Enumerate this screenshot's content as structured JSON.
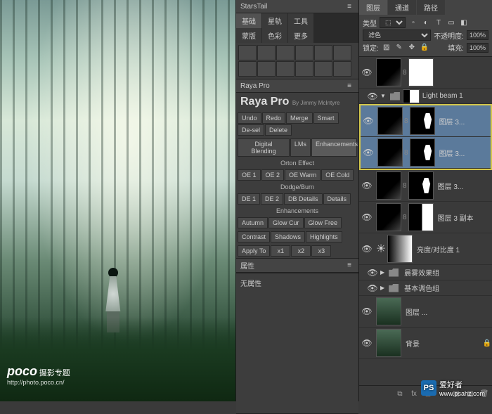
{
  "watermark_poco": {
    "logo": "poco",
    "sub": "摄影专题",
    "url": "http://photo.poco.cn/"
  },
  "watermark_ps": {
    "logo": "PS",
    "cn": "爱好者",
    "url": "www.psahz.com"
  },
  "starstail": {
    "title": "StarsTail",
    "tabs": [
      "基础",
      "星轨",
      "工具"
    ],
    "subtabs": [
      "蒙版",
      "色彩",
      "更多"
    ]
  },
  "raya": {
    "title": "Raya Pro",
    "by": "By Jimmy McIntyre",
    "row1": [
      "Undo",
      "Redo",
      "Merge",
      "Smart",
      "De-sel",
      "Delete"
    ],
    "row2": [
      "Digital Blending",
      "LMs",
      "Enhancements"
    ],
    "orton_label": "Orton Effect",
    "orton": [
      "OE 1",
      "OE 2",
      "OE Warm",
      "OE Cold"
    ],
    "dodge_label": "Dodge/Burn",
    "dodge": [
      "DE 1",
      "DE 2",
      "DB Details",
      "Details"
    ],
    "enh_label": "Enhancements",
    "enh1": [
      "Autumn",
      "Glow Cur",
      "Glow Free"
    ],
    "enh2": [
      "Contrast",
      "Shadows",
      "Highlights"
    ],
    "apply": "Apply To",
    "apply_opts": [
      "x1",
      "x2",
      "x3"
    ]
  },
  "props": {
    "title": "属性",
    "none": "无属性"
  },
  "layers": {
    "tabs": [
      "图层",
      "通道",
      "路径"
    ],
    "kind": "类型",
    "blend": "滤色",
    "opacity_label": "不透明度:",
    "opacity": "100%",
    "lock_label": "锁定:",
    "fill_label": "填充:",
    "fill": "100%",
    "items": [
      {
        "name": "Light beam 1",
        "type": "item-head"
      },
      {
        "name": "图层 3...",
        "sel": true
      },
      {
        "name": "图层 3...",
        "sel": true
      },
      {
        "name": "图层 3..."
      },
      {
        "name": "图层 3 副本"
      },
      {
        "name": "亮度/对比度 1",
        "adj": true
      },
      {
        "name": "晨雾效果组",
        "group": true
      },
      {
        "name": "基本调色组",
        "group": true
      },
      {
        "name": "图层 ..."
      },
      {
        "name": "背景",
        "bg": true
      }
    ]
  }
}
